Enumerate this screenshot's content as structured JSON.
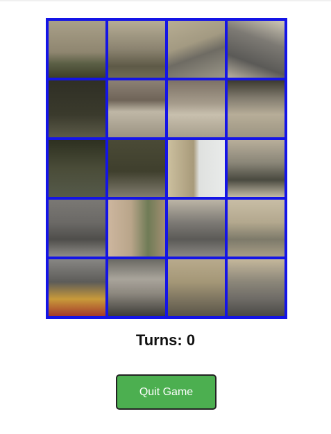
{
  "game": {
    "turns_label": "Turns: 0",
    "quit_label": "Quit Game"
  },
  "board": {
    "columns": 4,
    "rows": 5,
    "grid_color": "#1414e6",
    "tile_count": 20
  },
  "colors": {
    "quit_button_bg": "#4caf50",
    "quit_button_text": "#ffffff",
    "turns_text": "#111111"
  }
}
